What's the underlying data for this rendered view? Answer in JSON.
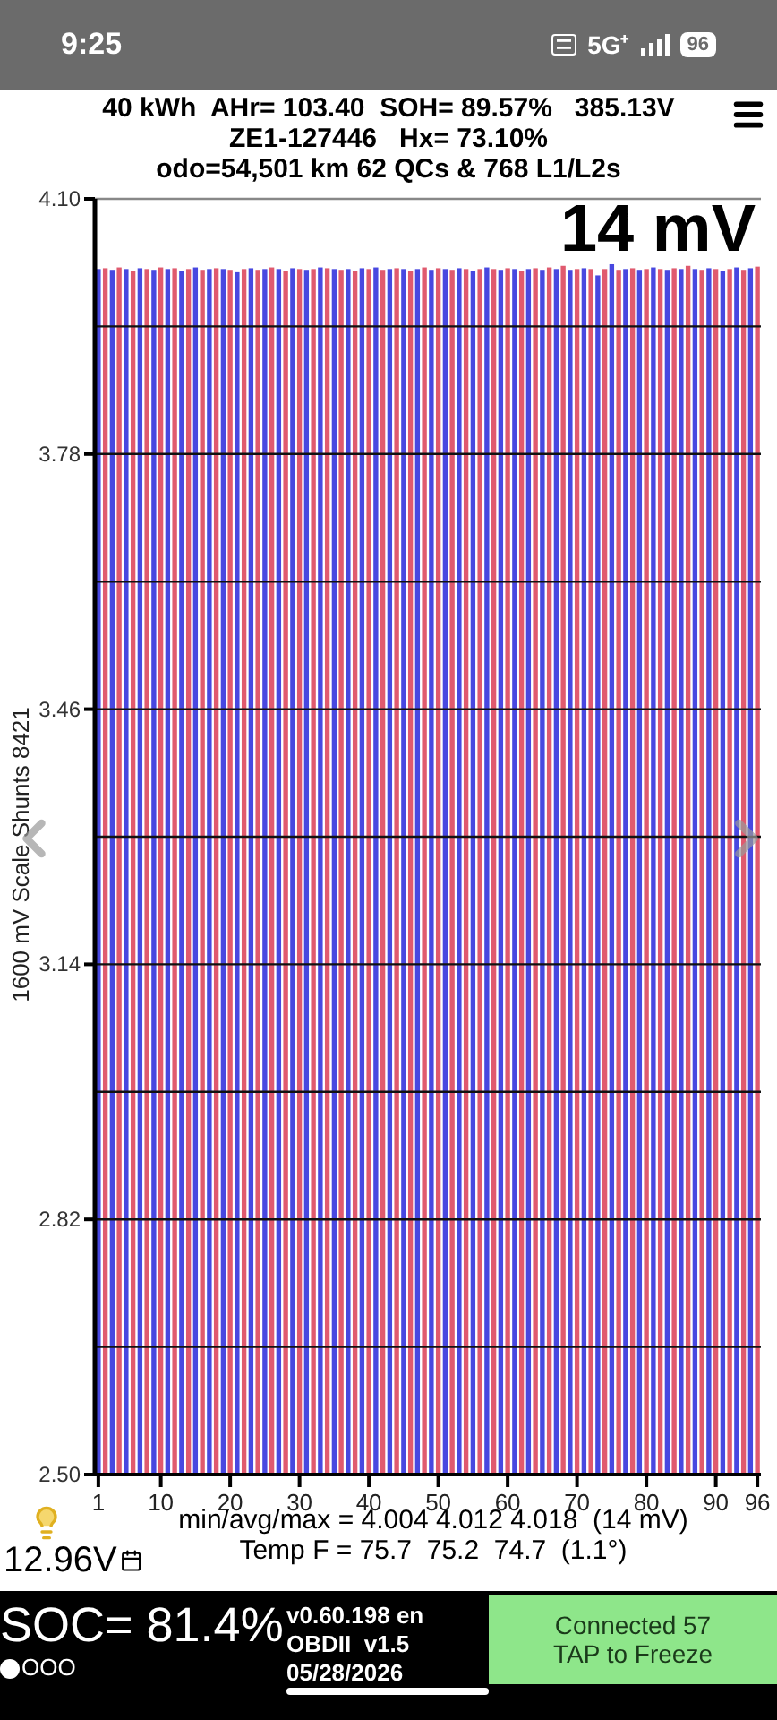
{
  "status_bar": {
    "time": "9:25",
    "network": "5G⁺",
    "battery": "96"
  },
  "header": {
    "lines": [
      "40 kWh  AHr= 103.40  SOH= 89.57%   385.13V",
      "ZE1-127446   Hx= 73.10%",
      "odo=54,501 km 62 QCs & 768 L1/L2s"
    ]
  },
  "chart": {
    "overlay": "14 mV",
    "chart_data": {
      "type": "bar",
      "ylabel": "1600 mV Scale  Shunts 8421",
      "grid": true,
      "xlim": [
        0.5,
        96.5
      ],
      "x": [
        1,
        2,
        3,
        4,
        5,
        6,
        7,
        8,
        9,
        10,
        11,
        12,
        13,
        14,
        15,
        16,
        17,
        18,
        19,
        20,
        21,
        22,
        23,
        24,
        25,
        26,
        27,
        28,
        29,
        30,
        31,
        32,
        33,
        34,
        35,
        36,
        37,
        38,
        39,
        40,
        41,
        42,
        43,
        44,
        45,
        46,
        47,
        48,
        49,
        50,
        51,
        52,
        53,
        54,
        55,
        56,
        57,
        58,
        59,
        60,
        61,
        62,
        63,
        64,
        65,
        66,
        67,
        68,
        69,
        70,
        71,
        72,
        73,
        74,
        75,
        76,
        77,
        78,
        79,
        80,
        81,
        82,
        83,
        84,
        85,
        86,
        87,
        88,
        89,
        90,
        91,
        92,
        93,
        94,
        95,
        96
      ],
      "series": [
        {
          "color": "#4848e0",
          "values": [
            4.012,
            null,
            4.011,
            null,
            4.012,
            null,
            4.013,
            null,
            4.011,
            null,
            4.012,
            null,
            4.01,
            null,
            4.014,
            null,
            4.012,
            null,
            4.012,
            null,
            4.008,
            null,
            4.013,
            null,
            4.012,
            null,
            4.012,
            null,
            4.013,
            null,
            4.011,
            null,
            4.014,
            null,
            4.012,
            null,
            4.012,
            null,
            4.013,
            null,
            4.014,
            null,
            4.012,
            null,
            4.012,
            null,
            4.012,
            null,
            4.011,
            null,
            4.012,
            null,
            4.013,
            null,
            4.01,
            null,
            4.014,
            null,
            4.011,
            null,
            4.012,
            null,
            4.012,
            null,
            4.011,
            null,
            4.012,
            null,
            4.011,
            null,
            4.013,
            null,
            4.004,
            null,
            4.018,
            null,
            4.012,
            null,
            4.011,
            null,
            4.014,
            null,
            4.011,
            null,
            4.012,
            null,
            4.012,
            null,
            4.013,
            null,
            4.01,
            null,
            4.014,
            null,
            4.013,
            null
          ]
        },
        {
          "color": "#e05a6e",
          "values": [
            null,
            4.013,
            null,
            4.014,
            null,
            4.01,
            null,
            4.012,
            null,
            4.014,
            null,
            4.013,
            null,
            4.012,
            null,
            4.011,
            null,
            4.013,
            null,
            4.011,
            null,
            4.012,
            null,
            4.011,
            null,
            4.014,
            null,
            4.01,
            null,
            4.012,
            null,
            4.012,
            null,
            4.013,
            null,
            4.011,
            null,
            4.01,
            null,
            4.012,
            null,
            4.011,
            null,
            4.013,
            null,
            4.01,
            null,
            4.014,
            null,
            4.013,
            null,
            4.011,
            null,
            4.012,
            null,
            4.012,
            null,
            4.012,
            null,
            4.013,
            null,
            4.01,
            null,
            4.013,
            null,
            4.014,
            null,
            4.016,
            null,
            4.012,
            null,
            4.012,
            null,
            4.012,
            null,
            4.011,
            null,
            4.013,
            null,
            4.012,
            null,
            4.012,
            null,
            4.013,
            null,
            4.016,
            null,
            4.011,
            null,
            4.012,
            null,
            4.012,
            null,
            4.011,
            null,
            4.015
          ]
        }
      ],
      "ylim": [
        2.5,
        4.1
      ],
      "yticks": [
        {
          "value": 2.5,
          "label": "2.50"
        },
        {
          "value": 2.82,
          "label": "2.82"
        },
        {
          "value": 3.14,
          "label": "3.14"
        },
        {
          "value": 3.46,
          "label": "3.46"
        },
        {
          "value": 3.78,
          "label": "3.78"
        },
        {
          "value": 4.1,
          "label": "4.10"
        }
      ],
      "xticks": [
        1,
        10,
        20,
        30,
        40,
        50,
        60,
        70,
        80,
        90,
        96
      ]
    }
  },
  "stats": [
    "min/avg/max = 4.004 4.012 4.018  (14 mV)",
    "Temp F = 75.7  75.2  74.7  (1.1°)"
  ],
  "aux_battery": "12.96V",
  "footer": {
    "soc": "SOC= 81.4%",
    "dots": "OOO",
    "version": [
      "v0.60.198 en",
      "OBDII  v1.5",
      "05/28/2026"
    ],
    "button": [
      "Connected 57",
      "TAP to Freeze"
    ]
  }
}
